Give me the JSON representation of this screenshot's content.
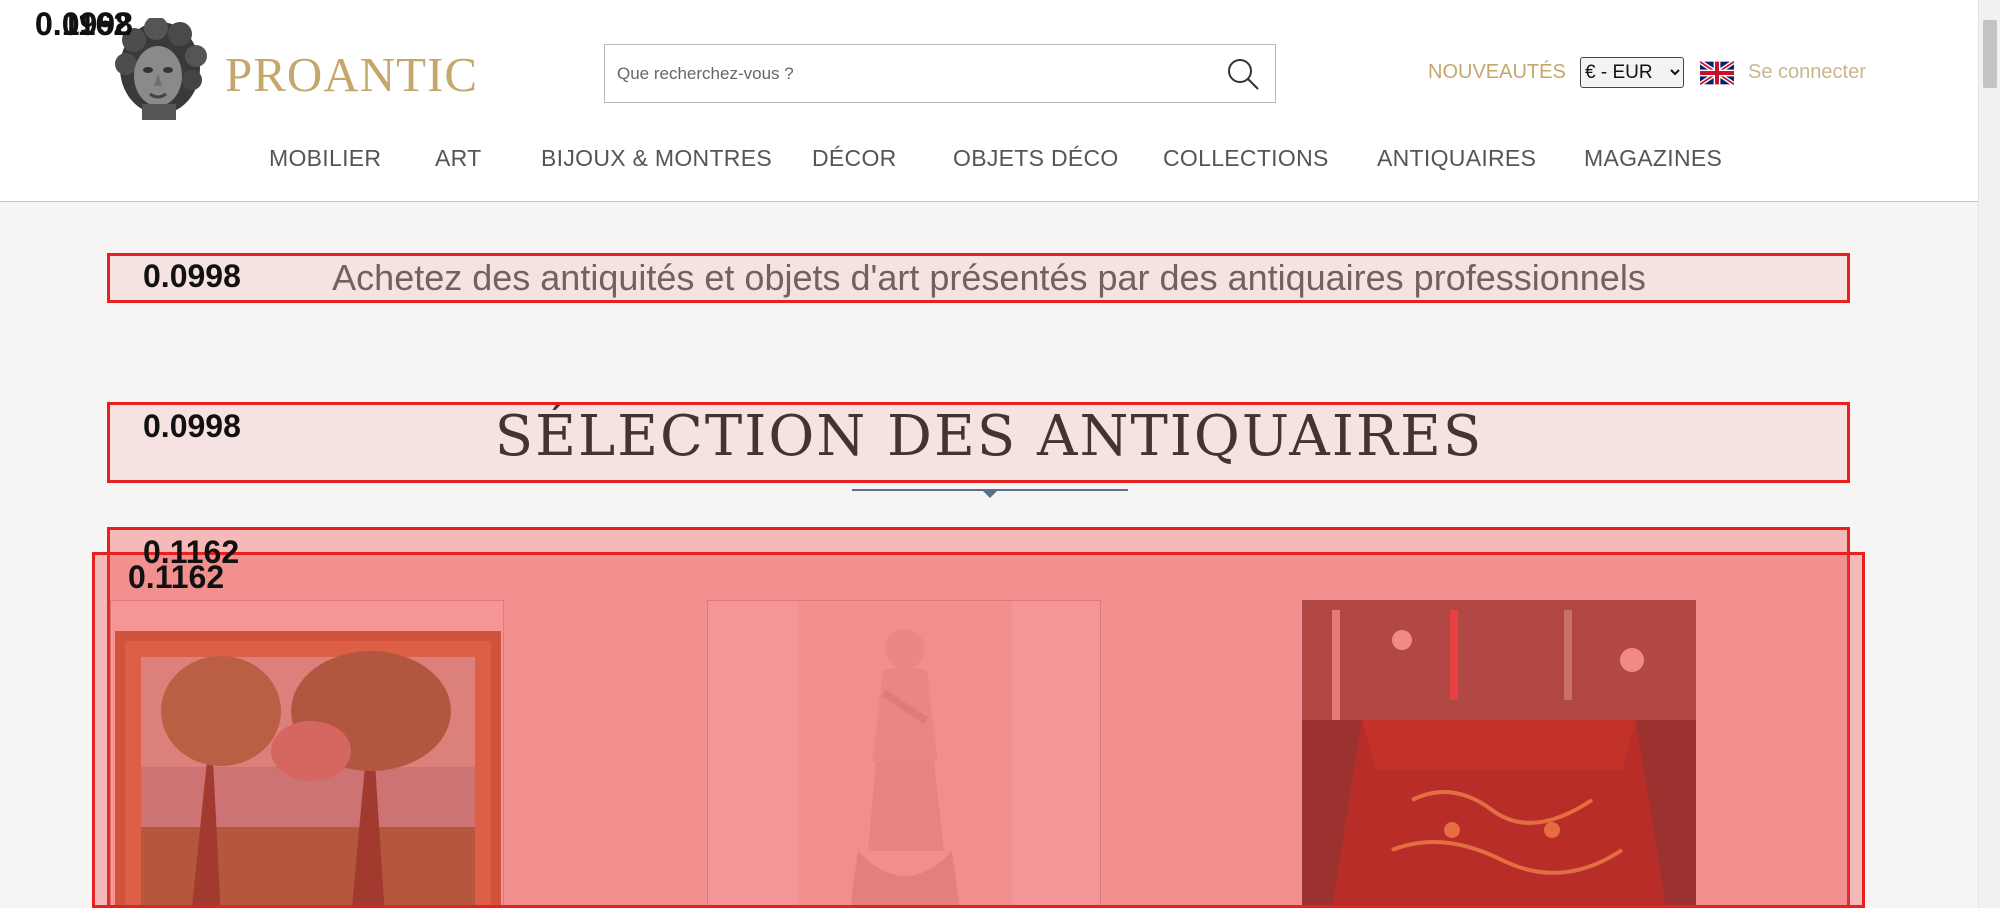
{
  "header": {
    "logo_text": "PROANTIC",
    "search": {
      "placeholder": "Que recherchez-vous ?"
    },
    "new_label": "NOUVEAUTÉS",
    "currency": {
      "selected": "€ - EUR"
    },
    "login_label": "Se connecter",
    "nav": [
      {
        "label": "MOBILIER"
      },
      {
        "label": "ART"
      },
      {
        "label": "BIJOUX & MONTRES"
      },
      {
        "label": "DÉCOR"
      },
      {
        "label": "OBJETS DÉCO"
      },
      {
        "label": "COLLECTIONS"
      },
      {
        "label": "ANTIQUAIRES"
      },
      {
        "label": "MAGAZINES"
      }
    ]
  },
  "main": {
    "tagline": "Achetez des antiquités et objets d'art présentés par des antiquaires professionnels",
    "section_title": "SÉLECTION DES ANTIQUAIRES",
    "products": [
      {
        "icon": "painting-image"
      },
      {
        "icon": "statue-image"
      },
      {
        "icon": "lacquer-box-image"
      }
    ]
  },
  "overlays": {
    "top_left_score_a": "0.1162",
    "top_left_score_b": "0.0998",
    "tagline_score": "0.0998",
    "title_score": "0.0998",
    "products_score_a": "0.1162",
    "products_score_b": "0.1162"
  },
  "colors": {
    "brand_gold": "#c5a76b",
    "overlay_red": "#e82020"
  }
}
